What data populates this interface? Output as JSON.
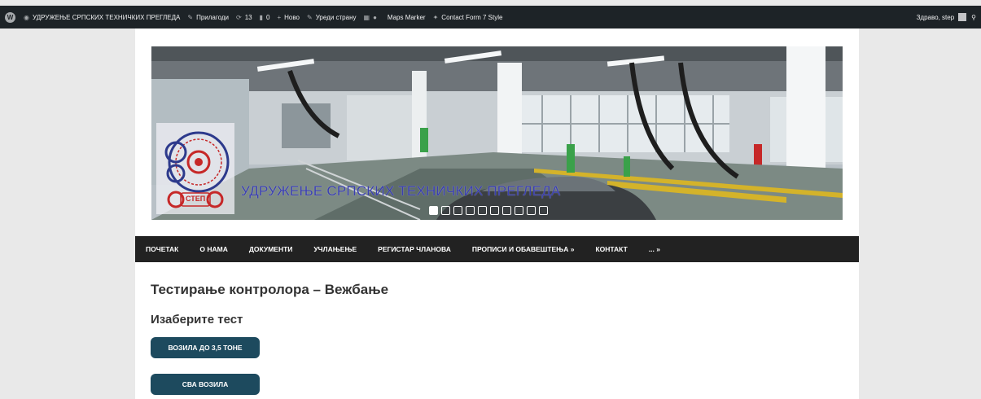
{
  "adminbar": {
    "site_name": "УДРУЖЕЊЕ СРПСКИХ ТЕХНИЧКИХ ПРЕГЛЕДА",
    "customize": "Прилагоди",
    "updates_count": "13",
    "comments_count": "0",
    "new_label": "Ново",
    "edit_page": "Уреди страну",
    "maps_marker": "Maps Marker",
    "cf7_style": "Contact Form 7 Style",
    "greeting": "Здраво, step"
  },
  "header": {
    "site_title": "УДРУЖЕЊЕ СРПСКИХ ТЕХНИЧКИХ ПРЕГЛЕДА",
    "logo_text": "СТЕП",
    "slider_count": 10,
    "slider_active": 1
  },
  "nav": {
    "items": [
      {
        "label": "ПОЧЕТАК"
      },
      {
        "label": "О НАМА"
      },
      {
        "label": "ДОКУМЕНТИ"
      },
      {
        "label": "УЧЛАЊЕЊЕ"
      },
      {
        "label": "РЕГИСТАР ЧЛАНОВА"
      },
      {
        "label": "ПРОПИСИ И ОБАВЕШТЕЊА »"
      },
      {
        "label": "КОНТАКТ"
      },
      {
        "label": "... »"
      }
    ]
  },
  "content": {
    "title": "Тестирање контролора – Вежбање",
    "subtitle": "Изаберите тест",
    "button_1": "ВОЗИЛА ДО 3,5 ТОНЕ",
    "button_2": "СВА ВОЗИЛА"
  },
  "colors": {
    "adminbar_bg": "#1d2327",
    "nav_bg": "#222222",
    "button_bg": "#1d4a5e",
    "title_color": "#3a3fb0"
  }
}
